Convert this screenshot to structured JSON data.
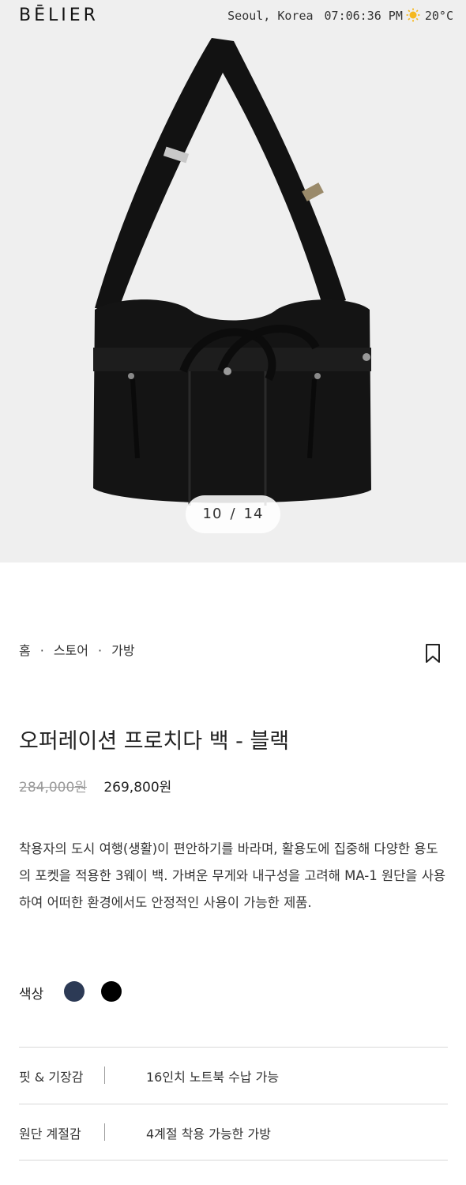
{
  "header": {
    "brand": "BĒLIER",
    "location": "Seoul, Korea",
    "time": "07:06:36 PM",
    "weather_icon": "sun-icon",
    "temperature": "20°C"
  },
  "gallery": {
    "current": "10",
    "separator": "/",
    "total": "14",
    "bag_color": "#111111",
    "background": "#efefef"
  },
  "breadcrumb": {
    "items": [
      "홈",
      "스토어",
      "가방"
    ],
    "separator": "·"
  },
  "product": {
    "title": "오퍼레이션 프로치다 백 - 블랙",
    "original_price": "284,000원",
    "sale_price": "269,800원",
    "description": "착용자의 도시 여행(생활)이 편안하기를 바라며, 활용도에 집중해 다양한 용도의 포켓을 적용한 3웨이 백. 가벼운 무게와 내구성을 고려해 MA-1 원단을 사용하여 어떠한 환경에서도 안정적인 사용이 가능한 제품.",
    "bookmark_icon": "bookmark-icon"
  },
  "colors": {
    "label": "색상",
    "swatches": [
      {
        "name": "navy",
        "hex": "#2c3a55"
      },
      {
        "name": "black",
        "hex": "#000000"
      }
    ]
  },
  "specs": [
    {
      "key": "핏 & 기장감",
      "value": "16인치 노트북 수납 가능"
    },
    {
      "key": "원단 계절감",
      "value": "4계절 착용 가능한 가방"
    }
  ]
}
